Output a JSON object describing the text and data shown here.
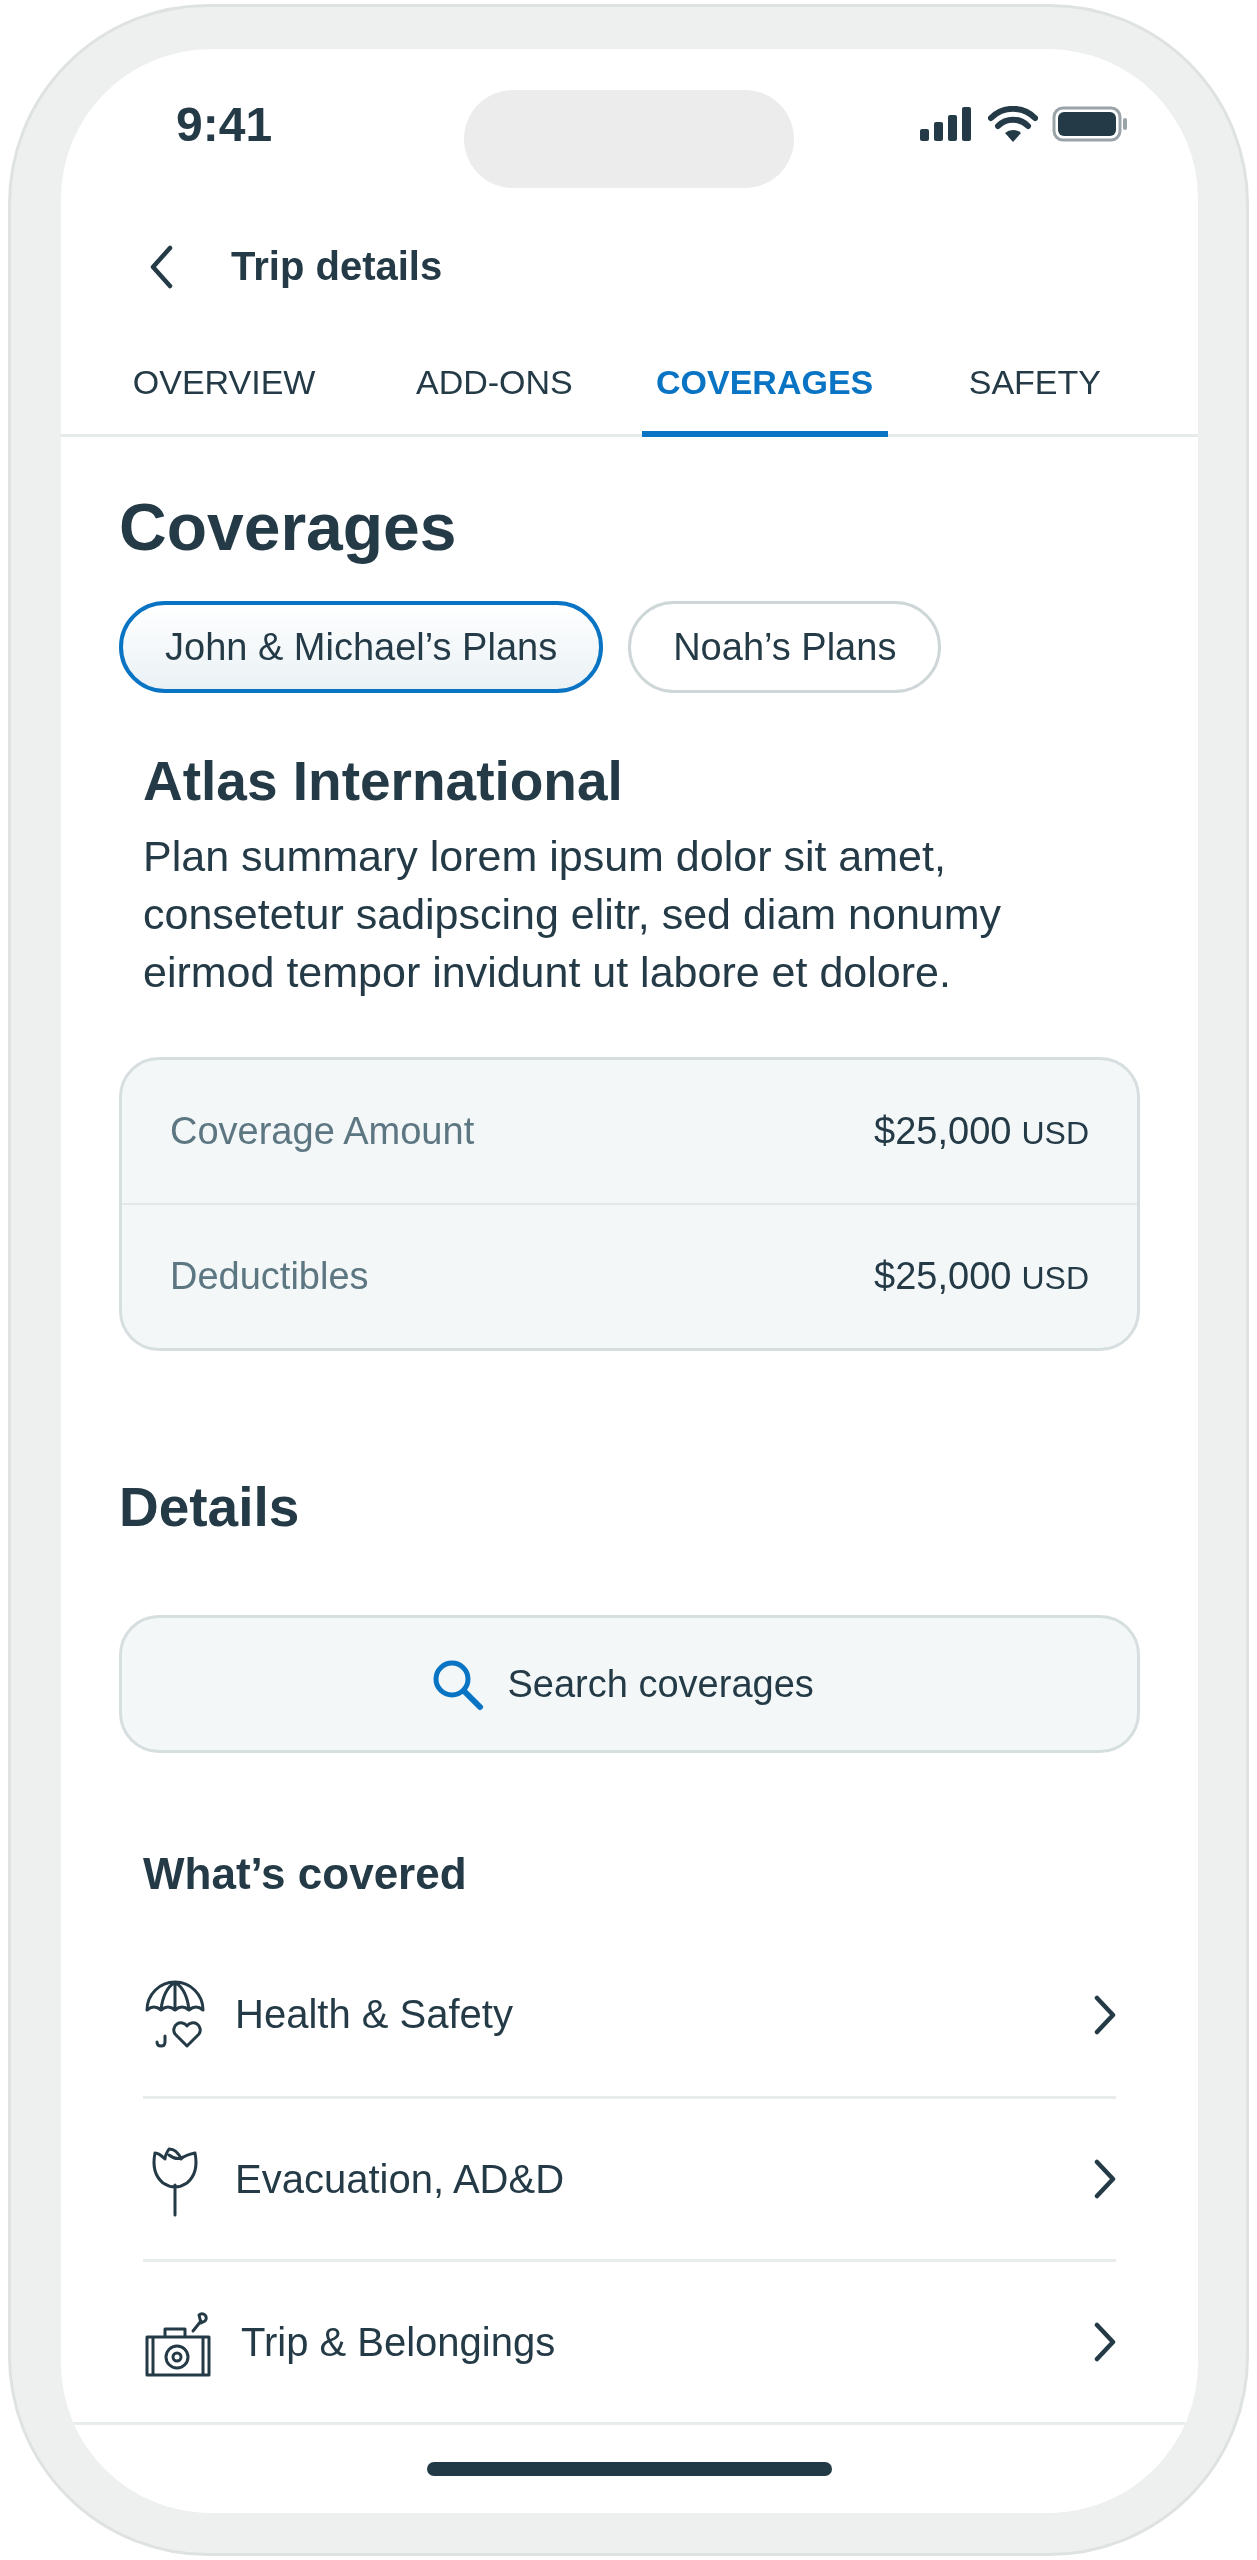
{
  "status_bar": {
    "time": "9:41"
  },
  "header": {
    "title": "Trip details"
  },
  "tabs": [
    {
      "label": "OVERVIEW",
      "selected": false
    },
    {
      "label": "ADD-ONS",
      "selected": false
    },
    {
      "label": "COVERAGES",
      "selected": true
    },
    {
      "label": "SAFETY",
      "selected": false
    }
  ],
  "page_title": "Coverages",
  "plan_chips": [
    {
      "label": "John & Michael’s Plans",
      "selected": true
    },
    {
      "label": "Noah’s Plans",
      "selected": false
    }
  ],
  "plan": {
    "name": "Atlas International",
    "summary": "Plan summary lorem ipsum dolor sit amet, consetetur sadipscing elitr, sed diam nonumy eirmod tempor invidunt ut labore et dolore."
  },
  "summary_rows": [
    {
      "label": "Coverage Amount",
      "amount": "$25,000",
      "currency": "USD"
    },
    {
      "label": "Deductibles",
      "amount": "$25,000",
      "currency": "USD"
    }
  ],
  "details_title": "Details",
  "search": {
    "placeholder": "Search coverages"
  },
  "covered_title": "What’s covered",
  "coverage_items": [
    {
      "label": "Health & Safety"
    },
    {
      "label": "Evacuation, AD&D"
    },
    {
      "label": "Trip & Belongings"
    }
  ]
}
